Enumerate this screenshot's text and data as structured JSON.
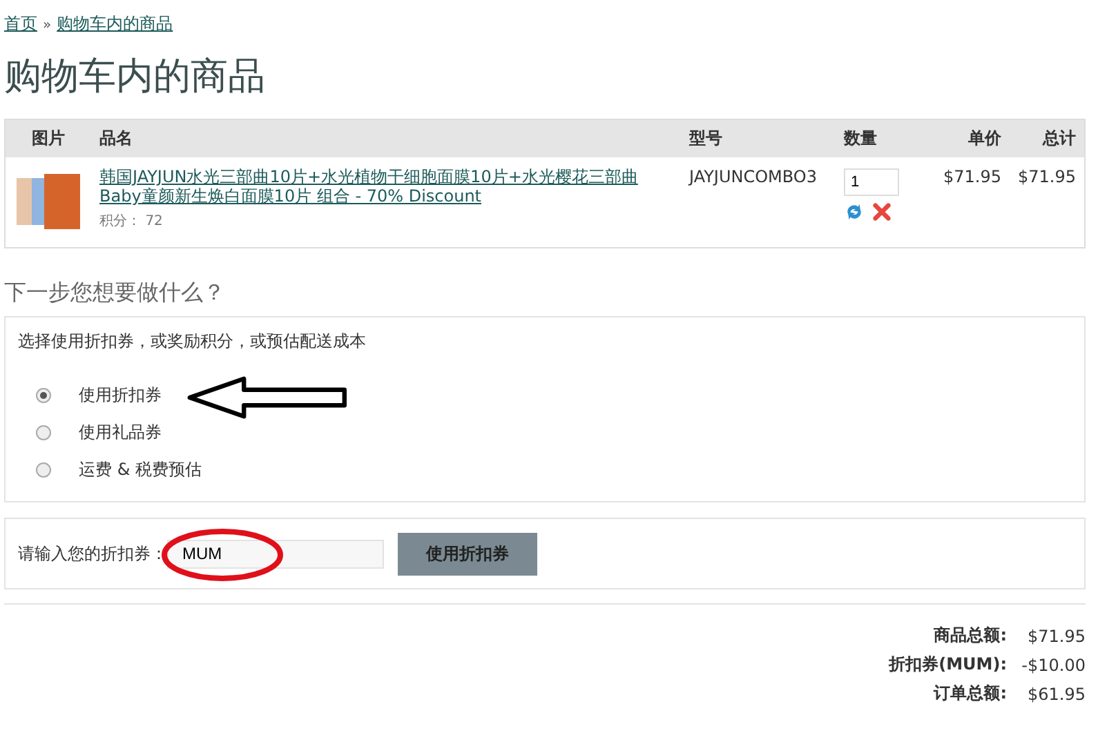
{
  "breadcrumb": {
    "items": [
      "首页",
      "购物车内的商品"
    ],
    "separator": "»"
  },
  "title": "购物车内的商品",
  "table": {
    "columns": [
      "图片",
      "品名",
      "型号",
      "数量",
      "单价",
      "总计"
    ],
    "rows": [
      {
        "name": "韩国JAYJUN水光三部曲10片+水光植物干细胞面膜10片+水光樱花三部曲Baby童颜新生焕白面膜10片 组合 - 70% Discount",
        "points_label": "积分：",
        "points": "72",
        "model": "JAYJUNCOMBO3",
        "quantity": "1",
        "unit_price": "$71.95",
        "total": "$71.95"
      }
    ]
  },
  "next_heading": "下一步您想要做什么？",
  "options": {
    "intro": "选择使用折扣券，或奖励积分，或预估配送成本",
    "items": [
      {
        "label": "使用折扣券",
        "selected": true
      },
      {
        "label": "使用礼品券",
        "selected": false
      },
      {
        "label": "运费 & 税费预估",
        "selected": false
      }
    ]
  },
  "coupon": {
    "label": "请输入您的折扣券：",
    "value": "MUM",
    "button": "使用折扣券"
  },
  "totals": [
    {
      "label": "商品总额:",
      "value": "$71.95"
    },
    {
      "label": "折扣券(MUM):",
      "value": "-$10.00"
    },
    {
      "label": "订单总额:",
      "value": "$61.95"
    }
  ]
}
